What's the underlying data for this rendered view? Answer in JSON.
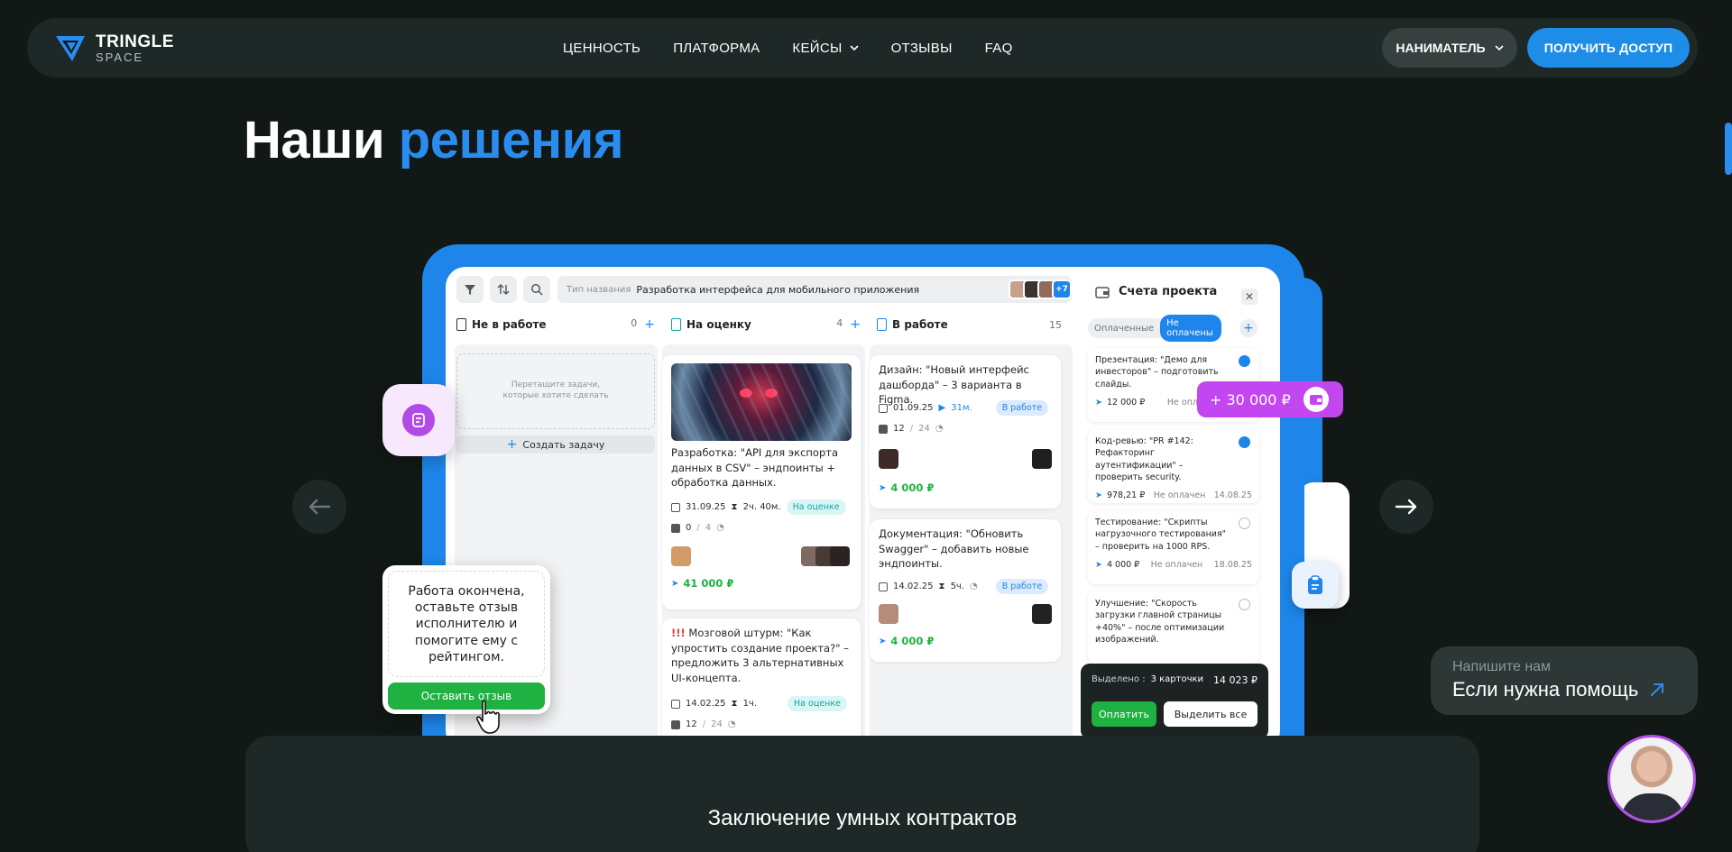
{
  "nav": {
    "logo_title": "TRINGLE",
    "logo_sub": "SPACE",
    "menu": [
      "ЦЕННОСТЬ",
      "ПЛАТФОРМА",
      "КЕЙСЫ",
      "ОТЗЫВЫ",
      "FAQ"
    ],
    "employer": "НАНИМАТЕЛЬ",
    "access": "ПОЛУЧИТЬ ДОСТУП"
  },
  "heading": {
    "part1": "Наши",
    "part2": "решения"
  },
  "app": {
    "search_placeholder": "Тип названия",
    "search_value": "Разработка интерфейса для мобильного приложения",
    "avatars_more": "+7",
    "columns": [
      {
        "title": "Не в работе",
        "count": "0"
      },
      {
        "title": "На оценку",
        "count": "4"
      },
      {
        "title": "В работе",
        "count": "15"
      }
    ],
    "drop_hint": "Перетащите задачи, которые хотите сделать",
    "create_task": "Создать задачу",
    "cards": {
      "c1": {
        "title": "Разработка: \"API для экспорта данных в CSV\" – эндпоинты + обработка данных.",
        "date": "31.09.25",
        "time": "2ч. 40м.",
        "status": "На оценке",
        "checks": "0",
        "checks_total": "4",
        "price": "41 000 ₽"
      },
      "c2": {
        "warn": "!!!",
        "title": "Мозговой штурм: \"Как упростить создание проекта?\" – предложить 3 альтернативных UI-концепта.",
        "date": "14.02.25",
        "time": "1ч.",
        "status": "На оценке",
        "checks": "12",
        "checks_total": "24"
      },
      "c3": {
        "title": "Дизайн: \"Новый интерфейс дашборда\" – 3 варианта в Figma.",
        "date": "01.09.25",
        "time": "31м.",
        "status": "В работе",
        "checks": "12",
        "checks_total": "24",
        "price": "4 000 ₽"
      },
      "c4": {
        "title": "Документация: \"Обновить Swagger\" – добавить новые эндпоинты.",
        "date": "14.02.25",
        "time": "5ч.",
        "status": "В работе",
        "price": "4 000 ₽"
      }
    },
    "accounts": {
      "title": "Счета проекта",
      "tab_paid": "Оплаченные",
      "tab_unpaid": "Не оплачены",
      "invoices": [
        {
          "title": "Презентация: \"Демо для инвесторов\" – подготовить слайды.",
          "amount": "12 000 ₽",
          "status": "Не опл",
          "checked": true
        },
        {
          "title": "Код-ревью: \"PR #142: Рефакторинг аутентификации\" – проверить security.",
          "amount": "978,21 ₽",
          "status": "Не оплачен",
          "date": "14.08.25",
          "checked": true
        },
        {
          "title": "Тестирование: \"Скрипты нагрузочного тестирования\" – проверить на 1000 RPS.",
          "amount": "4 000 ₽",
          "status": "Не оплачен",
          "date": "18.08.25",
          "checked": false
        },
        {
          "title": "Улучшение: \"Скорость загрузки главной страницы +40%\" – после оптимизации изображений.",
          "checked": false
        }
      ],
      "selected_label": "Выделено :",
      "selected_value": "3 карточки",
      "selected_sum": "14 023 ₽",
      "pay": "Оплатить",
      "select_all": "Выделить все"
    }
  },
  "floating": {
    "money": "+ 30 000 ₽",
    "review_text": "Работа окончена, оставьте отзыв исполнителю и помогите ему с рейтингом.",
    "review_button": "Оставить отзыв"
  },
  "bottom": {
    "title": "Заключение умных контрактов"
  },
  "help": {
    "small": "Напишите нам",
    "big": "Если нужна помощь"
  },
  "colors": {
    "accent": "#1e86ea",
    "background": "#111816",
    "green": "#1fb141",
    "purple": "#c347f0"
  }
}
